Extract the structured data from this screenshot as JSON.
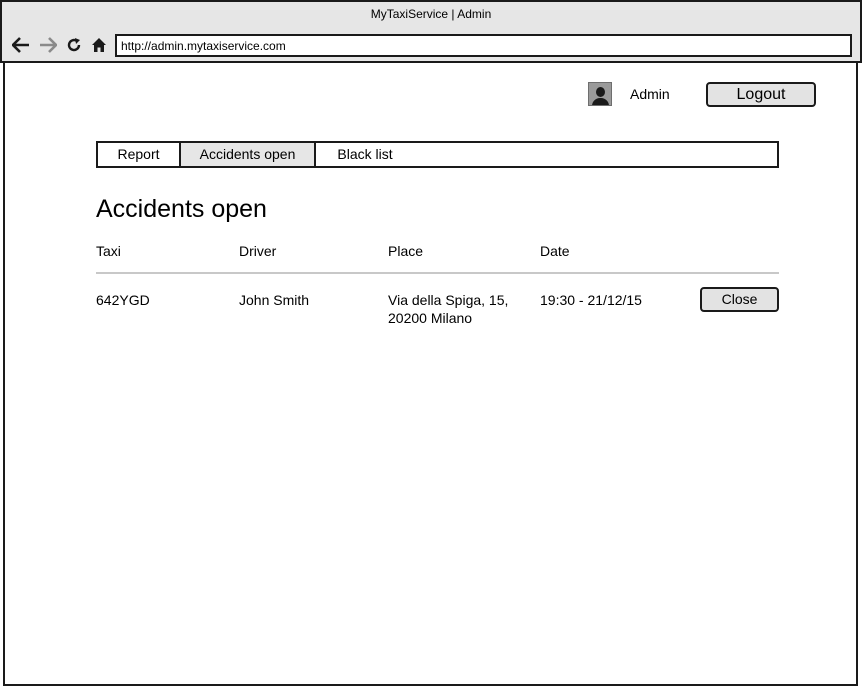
{
  "window": {
    "title": "MyTaxiService | Admin"
  },
  "browser": {
    "back_icon": "arrow-left-icon",
    "forward_icon": "arrow-right-icon",
    "reload_icon": "reload-icon",
    "home_icon": "home-icon",
    "url": "http://admin.mytaxiservice.com"
  },
  "user": {
    "avatar_icon": "user-avatar-icon",
    "name": "Admin",
    "logout_label": "Logout"
  },
  "tabs": [
    {
      "label": "Report",
      "active": false
    },
    {
      "label": "Accidents open",
      "active": true
    },
    {
      "label": "Black list",
      "active": false
    }
  ],
  "page": {
    "title": "Accidents open"
  },
  "table": {
    "columns": [
      "Taxi",
      "Driver",
      "Place",
      "Date"
    ],
    "rows": [
      {
        "taxi": "642YGD",
        "driver": "John Smith",
        "place": "Via della Spiga, 15, 20200 Milano",
        "date": "19:30 - 21/12/15",
        "action_label": "Close"
      }
    ]
  }
}
